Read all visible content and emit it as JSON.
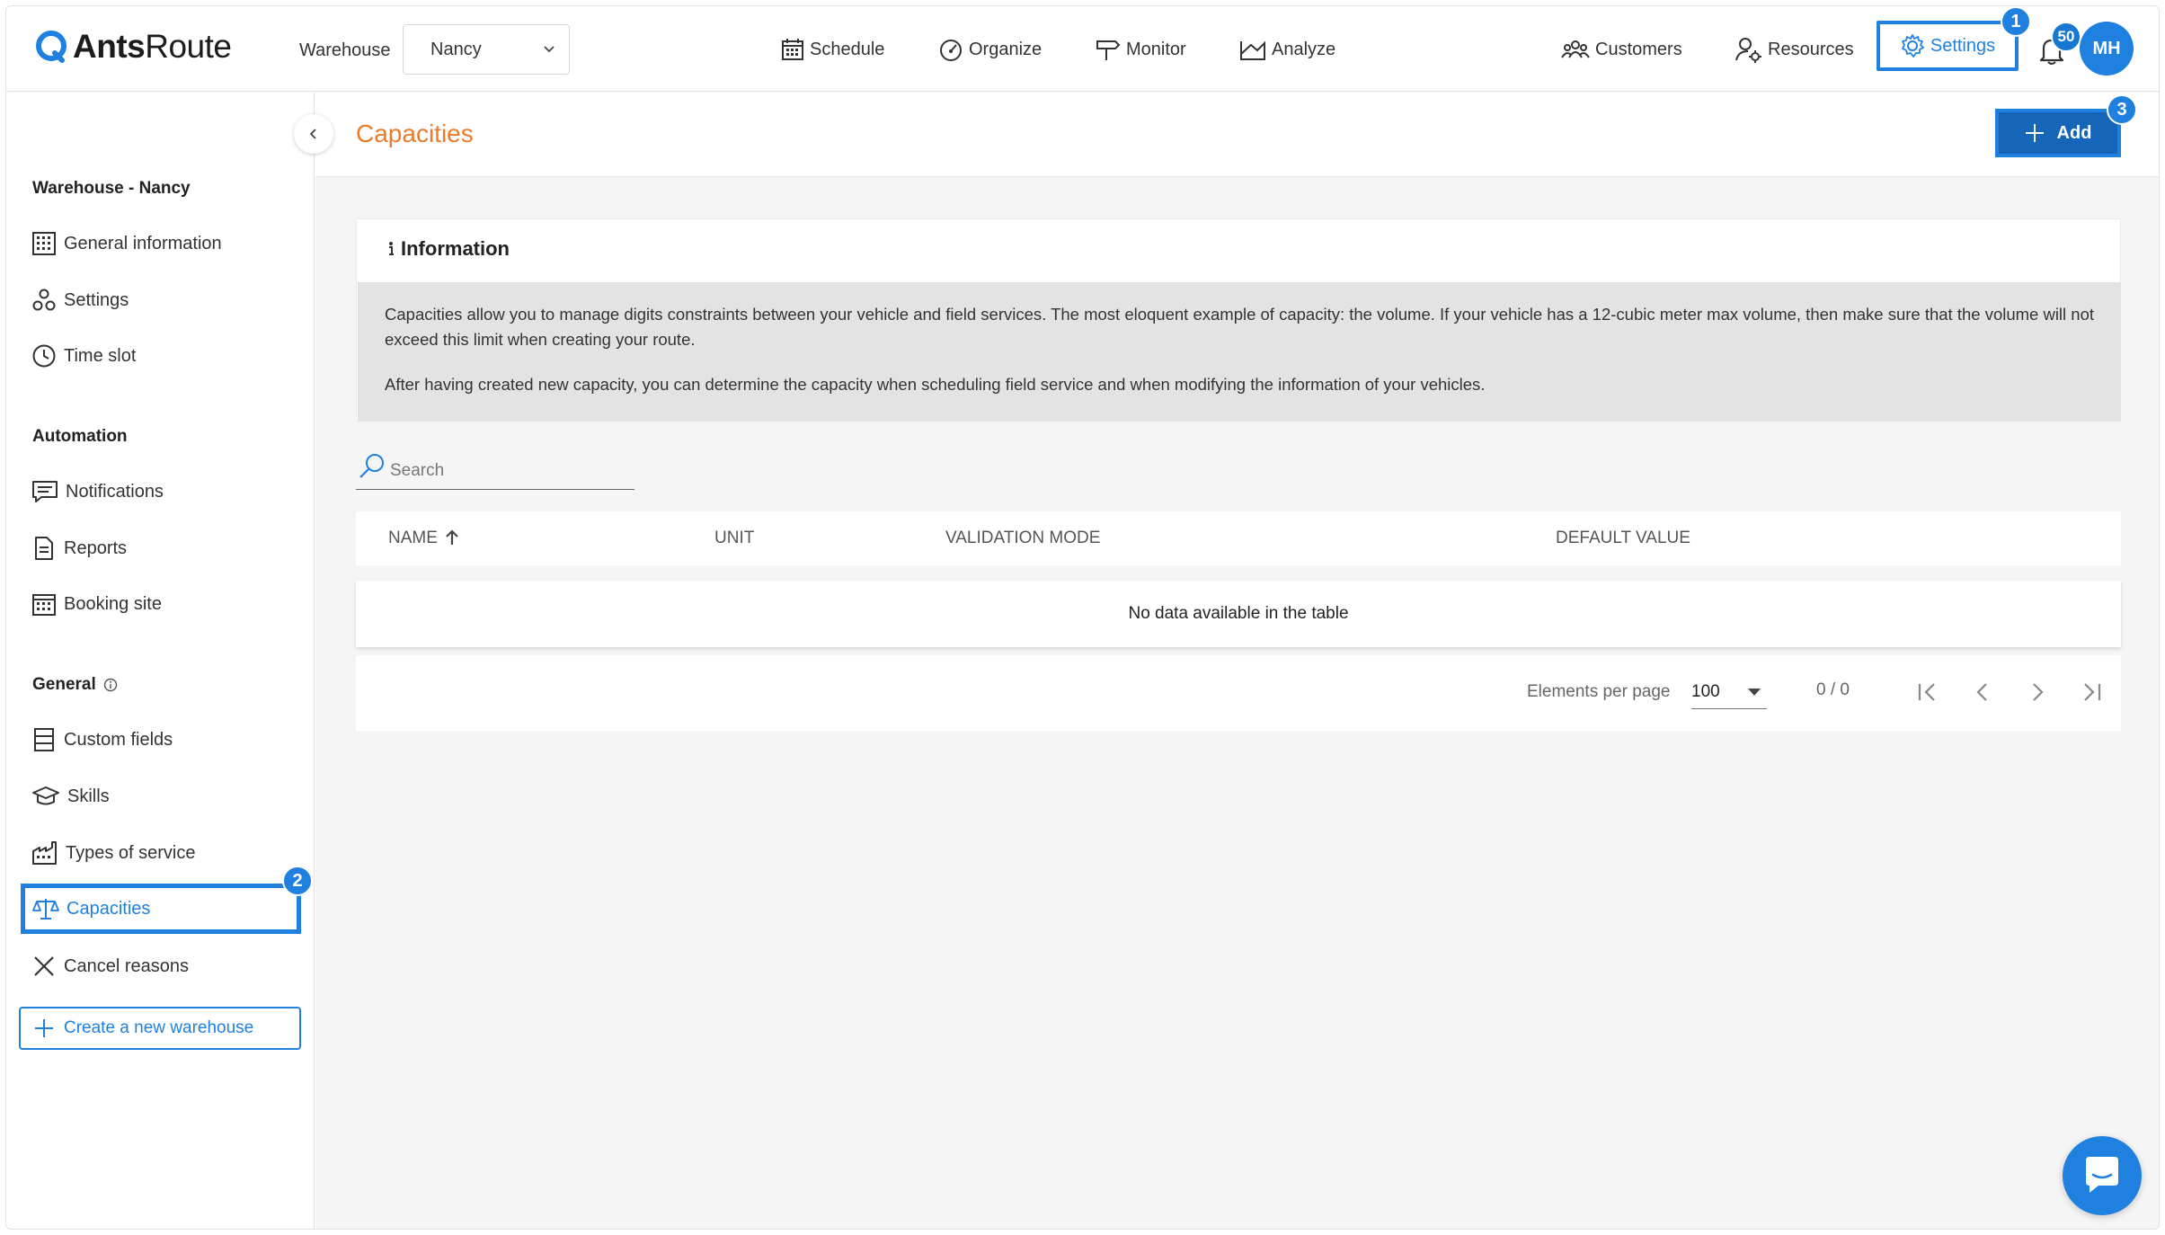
{
  "app": {
    "brand_bold": "Ants",
    "brand_rest": "Route"
  },
  "topbar": {
    "warehouse_label": "Warehouse",
    "warehouse_value": "Nancy",
    "nav": {
      "schedule": "Schedule",
      "organize": "Organize",
      "monitor": "Monitor",
      "analyze": "Analyze",
      "customers": "Customers",
      "resources": "Resources",
      "settings": "Settings"
    },
    "notification_count": "50",
    "avatar_initials": "MH"
  },
  "steps": {
    "one": "1",
    "two": "2",
    "three": "3"
  },
  "sidebar": {
    "warehouse_heading": "Warehouse - Nancy",
    "automation_heading": "Automation",
    "general_heading": "General",
    "items": {
      "general_information": "General information",
      "settings": "Settings",
      "time_slot": "Time slot",
      "notifications": "Notifications",
      "reports": "Reports",
      "booking_site": "Booking site",
      "custom_fields": "Custom fields",
      "skills": "Skills",
      "types_of_service": "Types of service",
      "capacities": "Capacities",
      "cancel_reasons": "Cancel reasons"
    },
    "create_warehouse": "Create a new warehouse"
  },
  "page": {
    "title": "Capacities",
    "add_label": "Add",
    "info_title": "Information",
    "info_p1": "Capacities allow you to manage digits constraints between your vehicle and field services. The most eloquent example of capacity: the volume. If your vehicle has a 12-cubic meter max volume, then make sure that the volume will not exceed this limit when creating your route.",
    "info_p2": "After having created new capacity, you can determine the capacity when scheduling field service and when modifying the information of your vehicles.",
    "search_placeholder": "Search",
    "columns": {
      "name": "NAME",
      "unit": "UNIT",
      "validation_mode": "VALIDATION MODE",
      "default_value": "DEFAULT VALUE"
    },
    "empty_message": "No data available in the table",
    "pagination": {
      "label": "Elements per page",
      "per_page": "100",
      "count": "0 / 0"
    }
  },
  "colors": {
    "accent": "#1f80e0",
    "title_orange": "#ee7a2b",
    "info_bg": "#e3e3e3"
  }
}
